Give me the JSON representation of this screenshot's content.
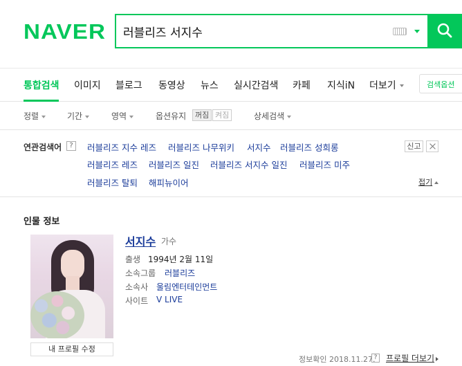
{
  "header": {
    "logo": "NAVER",
    "search_value": "러블리즈 서지수"
  },
  "tabs": [
    {
      "label": "통합검색",
      "active": true
    },
    {
      "label": "이미지"
    },
    {
      "label": "블로그"
    },
    {
      "label": "동영상"
    },
    {
      "label": "뉴스"
    },
    {
      "label": "실시간검색"
    },
    {
      "label": "카페"
    },
    {
      "label": "지식iN"
    },
    {
      "label": "더보기"
    }
  ],
  "search_options_label": "검색옵션",
  "options": {
    "sort": "정렬",
    "period": "기간",
    "area": "영역",
    "keep_option": "옵션유지",
    "off_label": "꺼짐",
    "on_label": "켜짐",
    "detail_search": "상세검색"
  },
  "related": {
    "title": "연관검색어",
    "help": "?",
    "links": [
      "러블리즈 지수 레즈",
      "러블리즈 나무위키",
      "서지수",
      "러블리즈 성희롱",
      "러블리즈 레즈",
      "러블리즈 일진",
      "러블리즈 서지수 일진",
      "러블리즈 미주",
      "러블리즈 탈퇴",
      "해피뉴이어"
    ],
    "report": "신고",
    "collapse": "접기"
  },
  "person": {
    "section_title": "인물 정보",
    "name": "서지수",
    "role": "가수",
    "birth_label": "출생",
    "birth_value": "1994년 2월 11일",
    "group_label": "소속그룹",
    "group_value": "러블리즈",
    "agency_label": "소속사",
    "agency_value": "울림엔터테인먼트",
    "site_label": "사이트",
    "site_value": "V LIVE",
    "edit_profile": "내 프로필 수정",
    "verified": "정보확인 2018.11.27.",
    "verified_help": "?",
    "more_profile": "프로필 더보기"
  },
  "colors": {
    "brand": "#03c75a",
    "link": "#1b3c9a"
  }
}
